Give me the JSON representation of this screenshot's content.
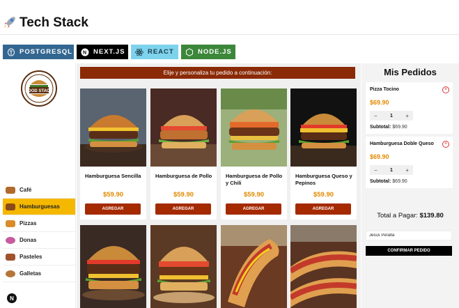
{
  "header": {
    "title": "Tech Stack",
    "icon": "rocket-icon"
  },
  "badges": [
    {
      "label": "POSTGRESQL",
      "icon": "postgresql-icon",
      "color": "#336791"
    },
    {
      "label": "NEXT.JS",
      "icon": "nextjs-icon",
      "color": "#000000"
    },
    {
      "label": "REACT",
      "icon": "react-icon",
      "color": "#7ed3ec"
    },
    {
      "label": "NODE.JS",
      "icon": "nodejs-icon",
      "color": "#3c873a"
    }
  ],
  "sidebar": {
    "logo_lines": [
      "FOOD STACK"
    ],
    "categories": [
      {
        "label": "Café",
        "active": false
      },
      {
        "label": "Hamburguesas",
        "active": true
      },
      {
        "label": "Pizzas",
        "active": false
      },
      {
        "label": "Donas",
        "active": false
      },
      {
        "label": "Pasteles",
        "active": false
      },
      {
        "label": "Galletas",
        "active": false
      }
    ],
    "bottom_badge": "N"
  },
  "main": {
    "banner": "Elije y personaliza tu pedido a continuación:",
    "products": [
      {
        "name": "Hamburguesa Sencilla",
        "price": "$59.90",
        "button": "AGREGAR"
      },
      {
        "name": "Hamburguesa de Pollo",
        "price": "$59.90",
        "button": "AGREGAR"
      },
      {
        "name": "Hamburguesa de Pollo y Chili",
        "price": "$59.90",
        "button": "AGREGAR"
      },
      {
        "name": "Hamburguesa Queso y Pepinos",
        "price": "$59.90",
        "button": "AGREGAR"
      }
    ]
  },
  "orders": {
    "title": "Mis Pedidos",
    "items": [
      {
        "name": "Pizza Tocino",
        "price": "$69.90",
        "quantity": "1",
        "subtotal_label": "Subtotal:",
        "subtotal": "$69.90"
      },
      {
        "name": "Hamburguesa Doble Queso",
        "price": "$69.90",
        "quantity": "1",
        "subtotal_label": "Subtotal:",
        "subtotal": "$69.90"
      }
    ],
    "total_label": "Total a Pagar:",
    "total": "$139.80",
    "name_value": "Jesus Peralta",
    "confirm_label": "CONFIRMAR PEDIDO"
  },
  "colors": {
    "accent": "#f5b800",
    "brand": "#a52a00",
    "price": "#e08a00"
  }
}
